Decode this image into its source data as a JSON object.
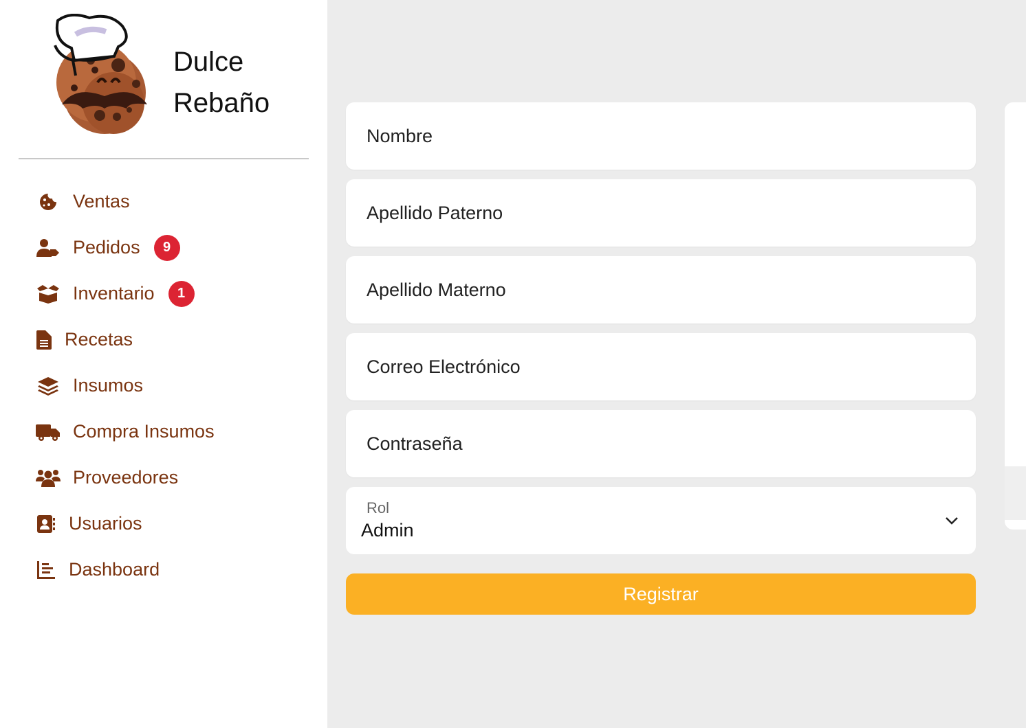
{
  "brand": {
    "name": "Dulce\nRebaño"
  },
  "nav": {
    "items": [
      {
        "label": "Ventas",
        "icon": "cookie-icon"
      },
      {
        "label": "Pedidos",
        "icon": "user-tag-icon",
        "badge": "9"
      },
      {
        "label": "Inventario",
        "icon": "box-open-icon",
        "badge": "1"
      },
      {
        "label": "Recetas",
        "icon": "file-lines-icon"
      },
      {
        "label": "Insumos",
        "icon": "layer-group-icon"
      },
      {
        "label": "Compra Insumos",
        "icon": "truck-icon"
      },
      {
        "label": "Proveedores",
        "icon": "users-icon"
      },
      {
        "label": "Usuarios",
        "icon": "address-book-icon"
      },
      {
        "label": "Dashboard",
        "icon": "chart-bar-icon"
      }
    ]
  },
  "form": {
    "nombre": "Nombre",
    "apellido_paterno": "Apellido Paterno",
    "apellido_materno": "Apellido Materno",
    "correo": "Correo Electrónico",
    "contrasena": "Contraseña",
    "rol_label": "Rol",
    "rol_value": "Admin",
    "submit_label": "Registrar"
  },
  "colors": {
    "nav_text": "#7a3410",
    "badge": "#dc2433",
    "button": "#fbb024",
    "background": "#ececec"
  }
}
